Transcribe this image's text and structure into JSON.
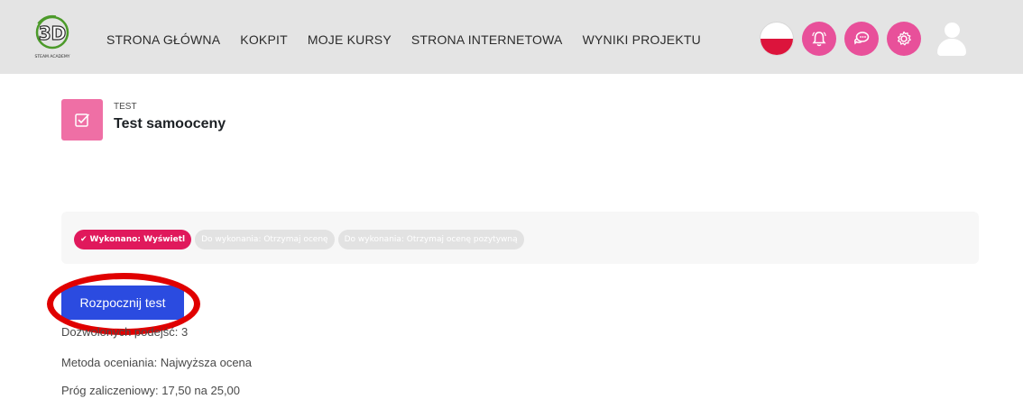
{
  "header": {
    "logo_text": "STEAM ACADEMY",
    "logo_mark": "3D",
    "nav": [
      {
        "label": "STRONA GŁÓWNA"
      },
      {
        "label": "KOKPIT"
      },
      {
        "label": "MOJE KURSY"
      },
      {
        "label": "STRONA INTERNETOWA"
      },
      {
        "label": "WYNIKI PROJEKTU"
      }
    ],
    "icons": [
      "poland-flag-icon",
      "notifications-icon",
      "messages-icon",
      "settings-icon",
      "user-avatar-icon"
    ]
  },
  "activity": {
    "type": "TEST",
    "title": "Test samooceny"
  },
  "completion": {
    "done_label": "Wykonano: Wyświetl",
    "todo_1": "Do wykonania: Otrzymaj ocenę",
    "todo_2": "Do wykonania: Otrzymaj ocenę pozytywną"
  },
  "actions": {
    "start_label": "Rozpocznij test"
  },
  "info": {
    "attempts": "Dozwolonych podejść: 3",
    "method": "Metoda oceniania: Najwyższa ocena",
    "threshold": "Próg zaliczeniowy: 17,50 na 25,00"
  },
  "colors": {
    "accent_pink": "#e8509a",
    "button_blue": "#2b4be0",
    "done_badge": "#e0195c",
    "highlight_ring": "#e00000"
  }
}
